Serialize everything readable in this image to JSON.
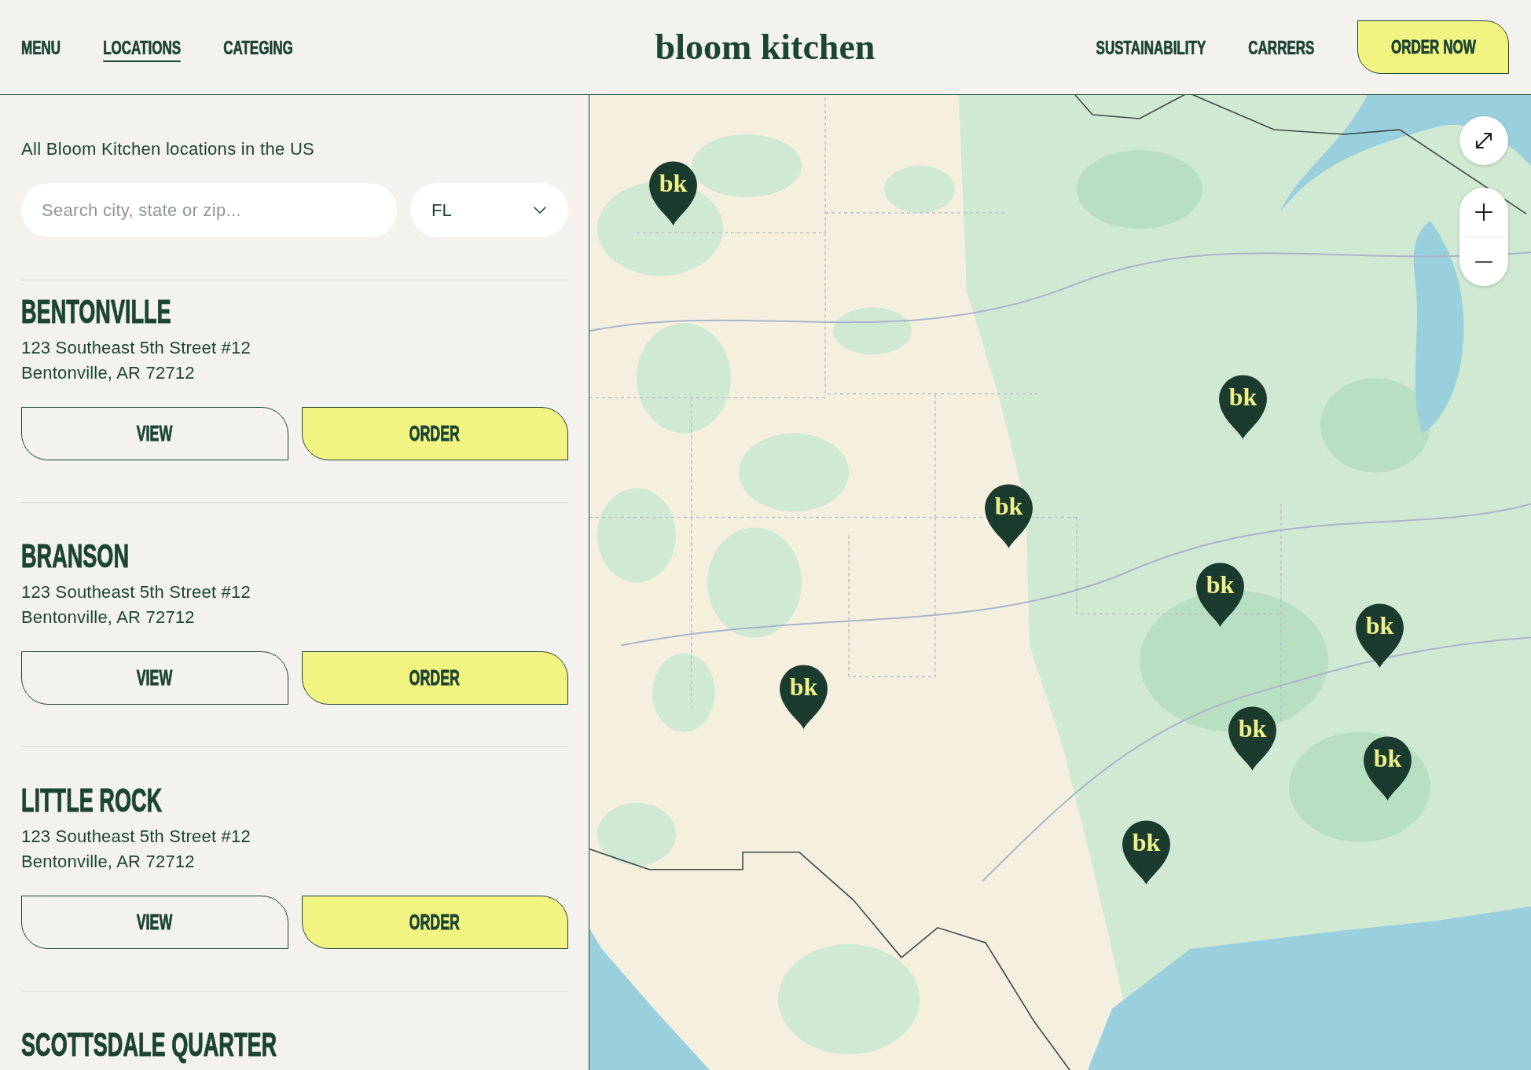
{
  "header": {
    "nav_left": [
      {
        "label": "MENU",
        "selected": false
      },
      {
        "label": "LOCATIONS",
        "selected": true
      },
      {
        "label": "CATEGING",
        "selected": false
      }
    ],
    "logo": "bloom kitchen",
    "nav_right": [
      {
        "label": "SUSTAINABILITY",
        "selected": false
      },
      {
        "label": "CARRERS",
        "selected": false
      }
    ],
    "cta": {
      "label": "ORDER NOW",
      "kind": "primary"
    }
  },
  "sidebar": {
    "intro": "All Bloom Kitchen locations in the US",
    "search": {
      "placeholder": "Search city, state or zip..."
    },
    "state_select": {
      "value": "FL"
    },
    "locations": [
      {
        "name": "BENTONVILLE",
        "address": [
          "123 Southeast 5th Street #12",
          "Bentonville, AR 72712"
        ],
        "actions": [
          {
            "label": "VIEW",
            "kind": "outline"
          },
          {
            "label": "ORDER",
            "kind": "primary"
          }
        ]
      },
      {
        "name": "BRANSON",
        "address": [
          "123 Southeast 5th Street #12",
          "Bentonville, AR 72712"
        ],
        "actions": [
          {
            "label": "VIEW",
            "kind": "outline"
          },
          {
            "label": "ORDER",
            "kind": "primary"
          }
        ]
      },
      {
        "name": "LITTLE ROCK",
        "address": [
          "123 Southeast 5th Street #12",
          "Bentonville, AR 72712"
        ],
        "actions": [
          {
            "label": "VIEW",
            "kind": "outline"
          },
          {
            "label": "ORDER",
            "kind": "primary"
          }
        ]
      },
      {
        "name": "SCOTTSDALE QUARTER"
      }
    ]
  },
  "map": {
    "pins": [
      {
        "label": "bk"
      },
      {
        "label": "bk"
      },
      {
        "label": "bk"
      },
      {
        "label": "bk"
      },
      {
        "label": "bk"
      },
      {
        "label": "bk"
      },
      {
        "label": "bk"
      },
      {
        "label": "bk"
      },
      {
        "label": "bk"
      }
    ]
  }
}
